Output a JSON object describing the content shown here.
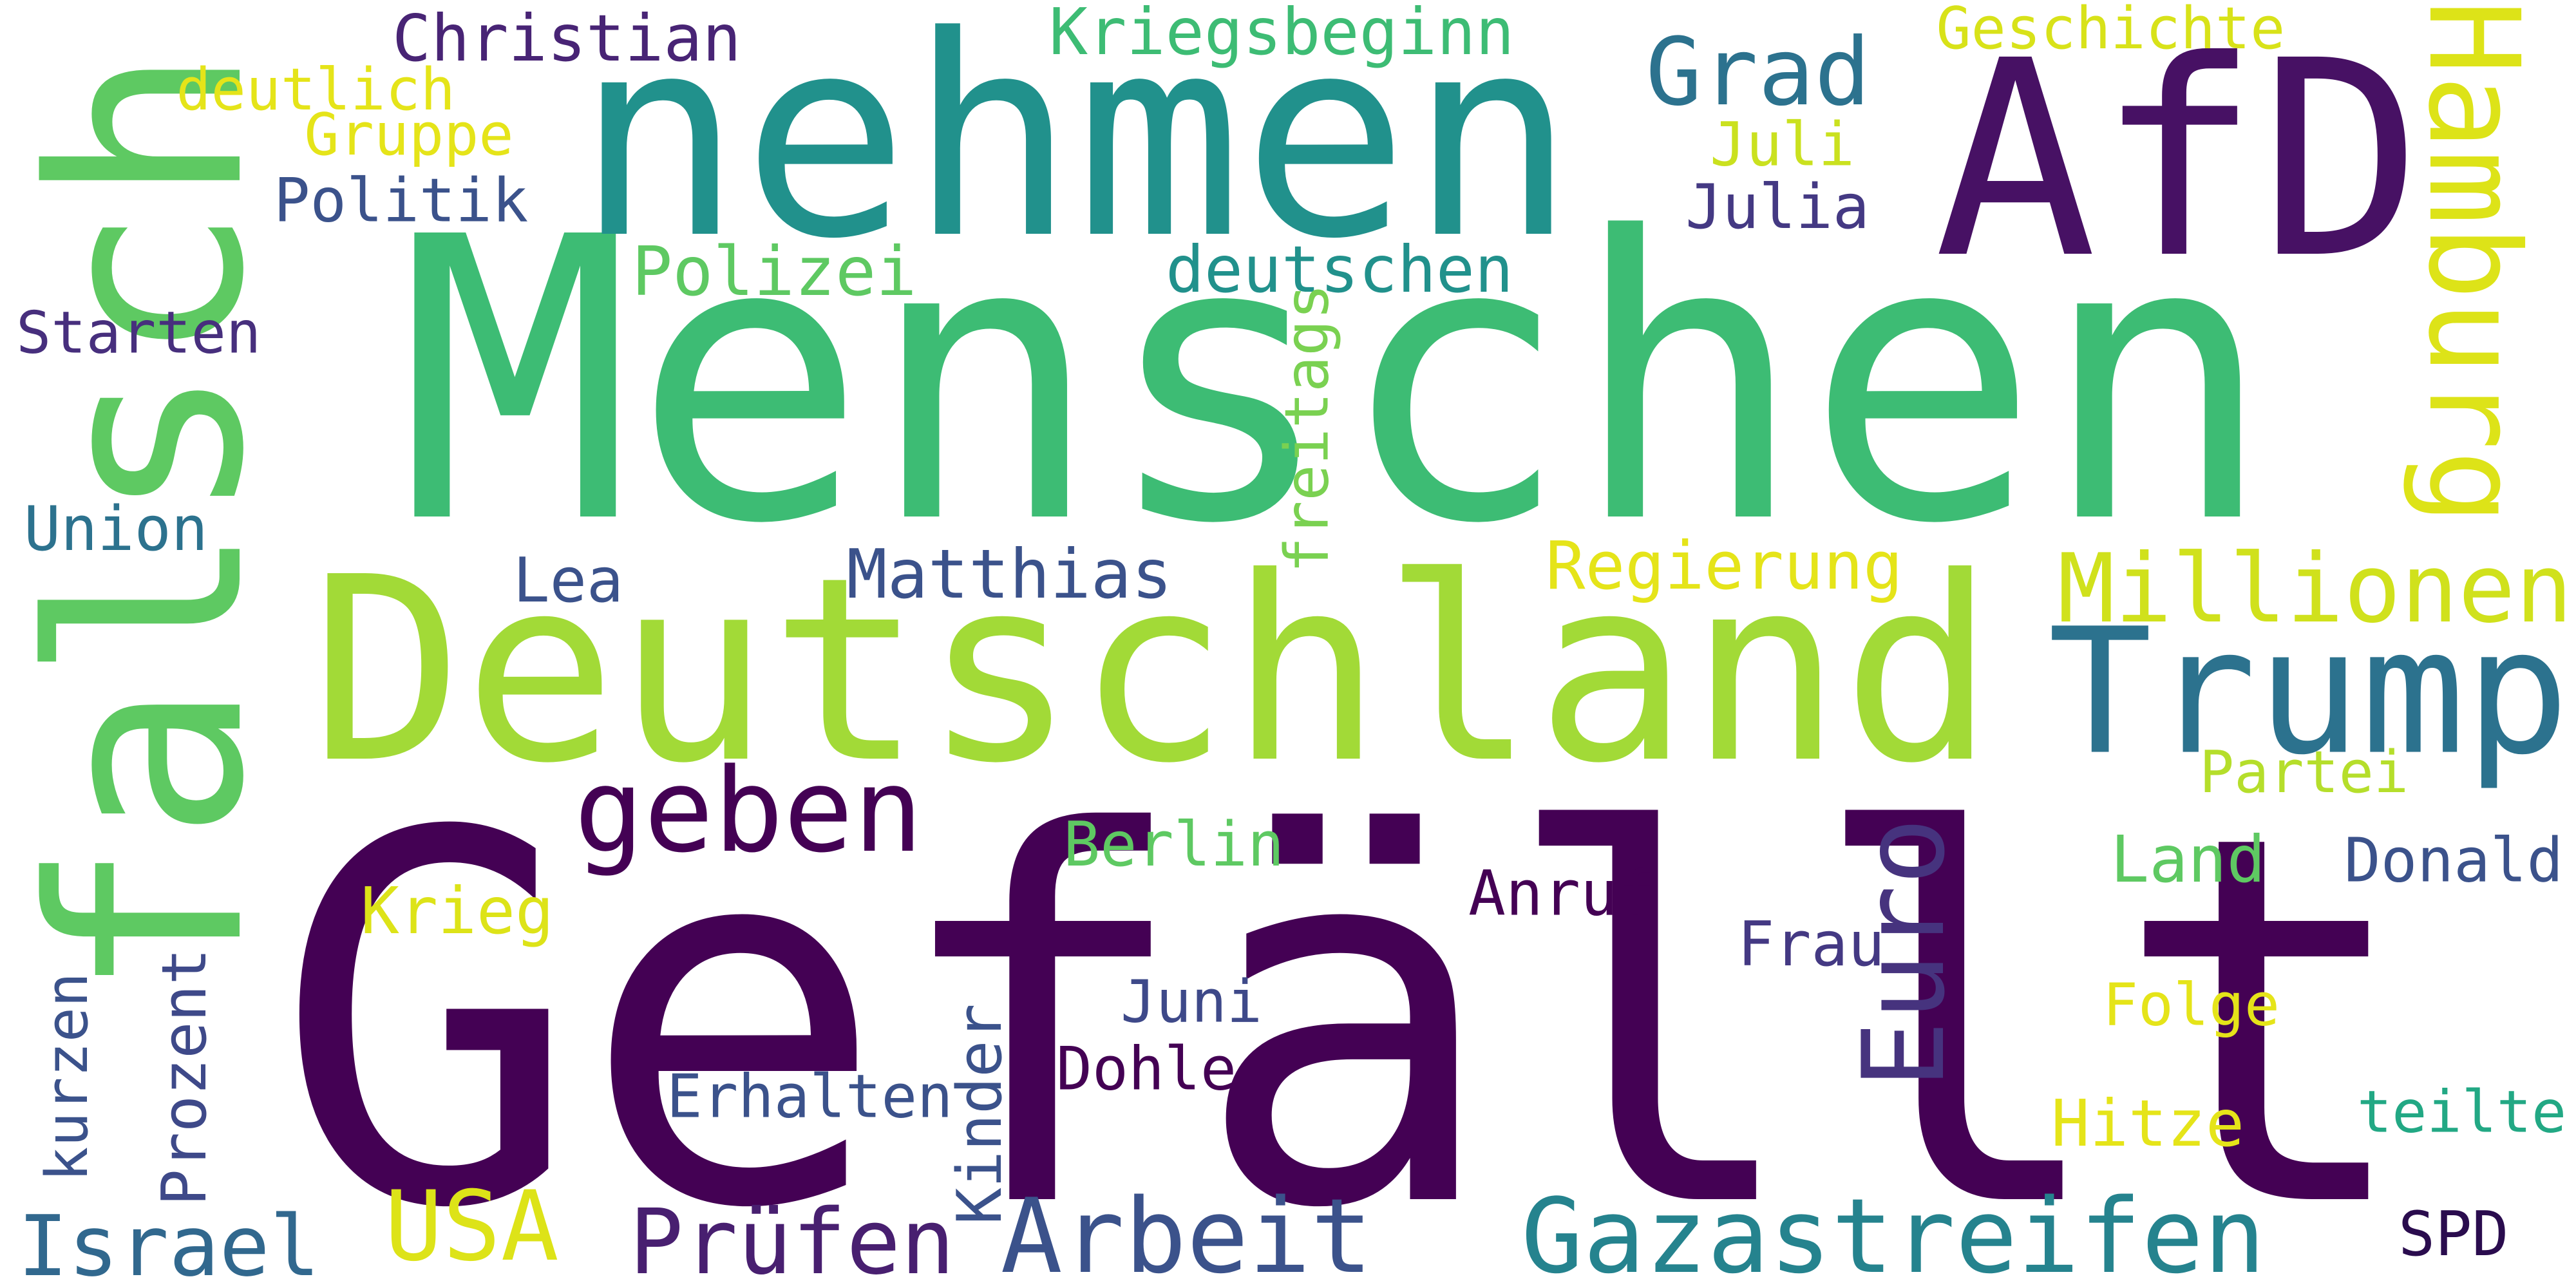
{
  "title": "",
  "words": [
    {
      "text": "Gefällt",
      "color": "#440154"
    },
    {
      "text": "Menschen",
      "color": "#3dbc74"
    },
    {
      "text": "Deutschland",
      "color": "#a2da37"
    },
    {
      "text": "nehmen",
      "color": "#21918c"
    },
    {
      "text": "AfD",
      "color": "#471164"
    },
    {
      "text": "falsch",
      "color": "#5ec962"
    },
    {
      "text": "Trump",
      "color": "#2c728e"
    },
    {
      "text": "Hamburg",
      "color": "#dde318"
    },
    {
      "text": "Gazastreifen",
      "color": "#25838e"
    },
    {
      "text": "Millionen",
      "color": "#d0e11c"
    },
    {
      "text": "Arbeit",
      "color": "#3b528b"
    },
    {
      "text": "geben",
      "color": "#440154"
    },
    {
      "text": "Prüfen",
      "color": "#481f70"
    },
    {
      "text": "Euro",
      "color": "#46337e"
    },
    {
      "text": "Israel",
      "color": "#31688e"
    },
    {
      "text": "USA",
      "color": "#dde318"
    },
    {
      "text": "Grad",
      "color": "#2c728e"
    },
    {
      "text": "Matthias",
      "color": "#3b528b"
    },
    {
      "text": "Regierung",
      "color": "#e5e419"
    },
    {
      "text": "Kriegsbeginn",
      "color": "#3dbc74"
    },
    {
      "text": "deutschen",
      "color": "#21918c"
    },
    {
      "text": "Christian",
      "color": "#482475"
    },
    {
      "text": "Geschichte",
      "color": "#d8e219"
    },
    {
      "text": "deutlich",
      "color": "#e5e419"
    },
    {
      "text": "Gruppe",
      "color": "#e5e419"
    },
    {
      "text": "Politik",
      "color": "#3b528b"
    },
    {
      "text": "Juli",
      "color": "#cae11f"
    },
    {
      "text": "Julia",
      "color": "#443983"
    },
    {
      "text": "Polizei",
      "color": "#5ec962"
    },
    {
      "text": "Starten",
      "color": "#472f7d"
    },
    {
      "text": "freitags",
      "color": "#7ad151"
    },
    {
      "text": "Union",
      "color": "#2c728e"
    },
    {
      "text": "Lea",
      "color": "#3b528b"
    },
    {
      "text": "Partei",
      "color": "#b5de2b"
    },
    {
      "text": "Berlin",
      "color": "#5ec962"
    },
    {
      "text": "Land",
      "color": "#5ec962"
    },
    {
      "text": "Donald",
      "color": "#3b528b"
    },
    {
      "text": "Anruf",
      "color": "#440154"
    },
    {
      "text": "Krieg",
      "color": "#dde318"
    },
    {
      "text": "Frau",
      "color": "#443983"
    },
    {
      "text": "Juni",
      "color": "#3e4989"
    },
    {
      "text": "Folge",
      "color": "#e5e419"
    },
    {
      "text": "Dohle",
      "color": "#440154"
    },
    {
      "text": "Erhalten",
      "color": "#3b528b"
    },
    {
      "text": "Hitze",
      "color": "#e5e419"
    },
    {
      "text": "teilte",
      "color": "#22a884"
    },
    {
      "text": "kurzen",
      "color": "#3b528b"
    },
    {
      "text": "Prozent",
      "color": "#3e4989"
    },
    {
      "text": "Kinder",
      "color": "#3b528b"
    },
    {
      "text": "SPD",
      "color": "#2a0c4e"
    }
  ]
}
